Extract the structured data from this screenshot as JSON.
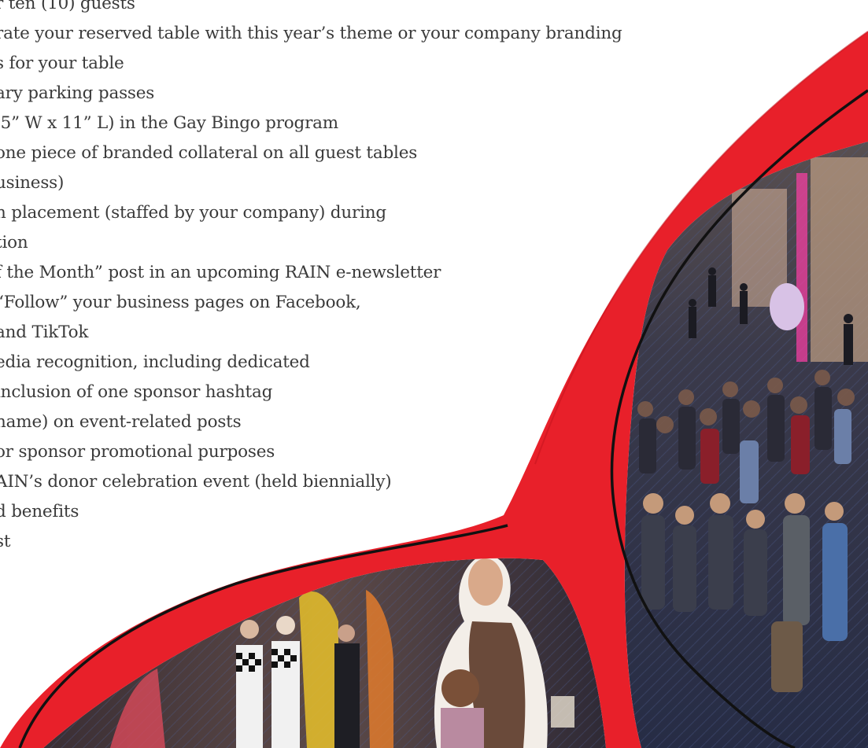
{
  "benefits": [
    "r ten (10) guests",
    "rate your reserved table with this year’s theme or your company branding",
    "s for your table",
    "ary parking passes",
    ".5” W x 11” L) in the Gay Bingo program",
    "one piece of branded collateral on all guest tables",
    "usiness)",
    "n placement (staffed by your company) during",
    "tion",
    "f the Month” post in an upcoming RAIN e-newsletter",
    "“Follow” your business pages on Facebook,",
    " and TikTok",
    "edia recognition, including dedicated",
    "inclusion of one sponsor hashtag",
    "name) on event-related posts",
    "or sponsor promotional purposes",
    "AIN’s donor celebration event (held biennially)",
    "d benefits",
    "st"
  ],
  "colors": {
    "ribbon_red": "#e8202a",
    "outline": "#111111",
    "text": "#3a3a3a",
    "carpet": "#2c3450"
  }
}
